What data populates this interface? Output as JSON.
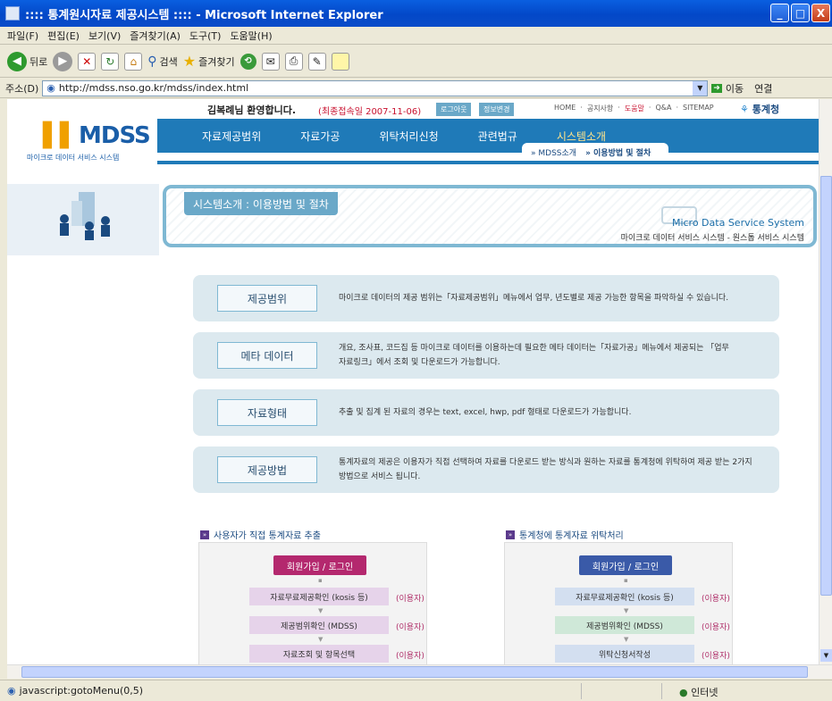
{
  "window": {
    "title": ":::: 통계원시자료 제공시스템 :::: - Microsoft Internet Explorer",
    "minimize": "_",
    "maximize": "□",
    "close": "X"
  },
  "menu": [
    "파일(F)",
    "편집(E)",
    "보기(V)",
    "즐겨찾기(A)",
    "도구(T)",
    "도움말(H)"
  ],
  "toolbar": {
    "back": "뒤로",
    "search": "검색",
    "favorites": "즐겨찾기"
  },
  "address": {
    "label": "주소(D)",
    "url": "http://mdss.nso.go.kr/mdss/index.html",
    "go": "이동",
    "links": "연결"
  },
  "top": {
    "welcome": "김복례님 환영합니다.",
    "lastlogin": "(최종접속일 2007-11-06)",
    "logout": "로그아웃",
    "info": "정보변경",
    "links": [
      "HOME",
      "공지사항",
      "도움말",
      "Q&A",
      "SITEMAP"
    ],
    "org": "통계청"
  },
  "logo": {
    "name": "MDSS",
    "sub": "마이크로 데이터 서비스 시스템"
  },
  "nav": [
    "자료제공범위",
    "자료가공",
    "위탁처리신청",
    "관련법규",
    "시스템소개"
  ],
  "subnav": [
    "MDSS소개",
    "이용방법 및 절차"
  ],
  "header": {
    "tab": "시스템소개 : 이용방법 및 절차",
    "en": "Micro Data Service System",
    "ko": "마이크로 데이터 서비스 시스템 - 원스톱 서비스 시스템"
  },
  "rows": [
    {
      "label": "제공범위",
      "text": "마이크로 데이터의 제공 범위는「자료제공범위」메뉴에서 업무, 년도별로 제공 가능한 항목을 파악하실 수 있습니다."
    },
    {
      "label": "메타 데이터",
      "text": "개요, 조사표, 코드집 등 마이크로 데이터를 이용하는데 필요한 메타 데이터는「자료가공」메뉴에서 제공되는 「업무자료링크」에서 조회 및 다운로드가 가능합니다."
    },
    {
      "label": "자료형태",
      "text": "추출 및 집계 된 자료의 경우는 text, excel, hwp, pdf 형태로 다운로드가 가능합니다."
    },
    {
      "label": "제공방법",
      "text": "통계자료의 제공은 이용자가 직접 선택하여 자료를 다운로드 받는 방식과 원하는 자료를 통계청에 위탁하여 제공 받는 2가지 방법으로 서비스 됩니다."
    }
  ],
  "flow_left": {
    "title": "사용자가 직접 통계자료 추출",
    "button": "회원가입 / 로그인",
    "steps": [
      "자료무료제공확인 (kosis 등)",
      "제공범위확인 (MDSS)",
      "자료조회 및 항목선택"
    ],
    "role": "(이용자)"
  },
  "flow_right": {
    "title": "통계청에 통계자료 위탁처리",
    "button": "회원가입 / 로그인",
    "steps": [
      "자료무료제공확인 (kosis 등)",
      "제공범위확인 (MDSS)",
      "위탁신청서작성"
    ],
    "role": "(이용자)"
  },
  "status": {
    "text": "javascript:gotoMenu(0,5)",
    "zone": "인터넷"
  },
  "colors": {
    "nav": "#1f7ab8",
    "frame": "#7fb8d3",
    "row": "#dce9ef",
    "btn_left": "#b4286e",
    "btn_right": "#3a5aa8"
  }
}
